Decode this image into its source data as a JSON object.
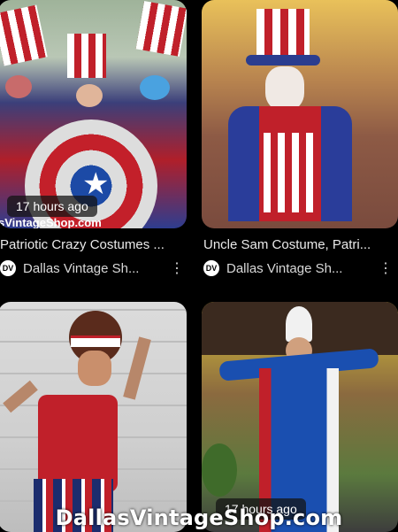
{
  "results": [
    {
      "badge": "17 hours ago",
      "overlay_text": "sVintageShop.com",
      "title": "Patriotic Crazy Costumes ...",
      "source": "Dallas Vintage Sh...",
      "more_icon": "more-vert-icon"
    },
    {
      "title": "Uncle Sam Costume, Patri...",
      "source": "Dallas Vintage Sh...",
      "more_icon": "more-vert-icon"
    },
    {
      "title": ""
    },
    {
      "badge": "17 hours ago"
    }
  ],
  "watermark": "DallasVintageShop.com",
  "colors": {
    "background": "#000000",
    "text": "#e8e8e8"
  }
}
